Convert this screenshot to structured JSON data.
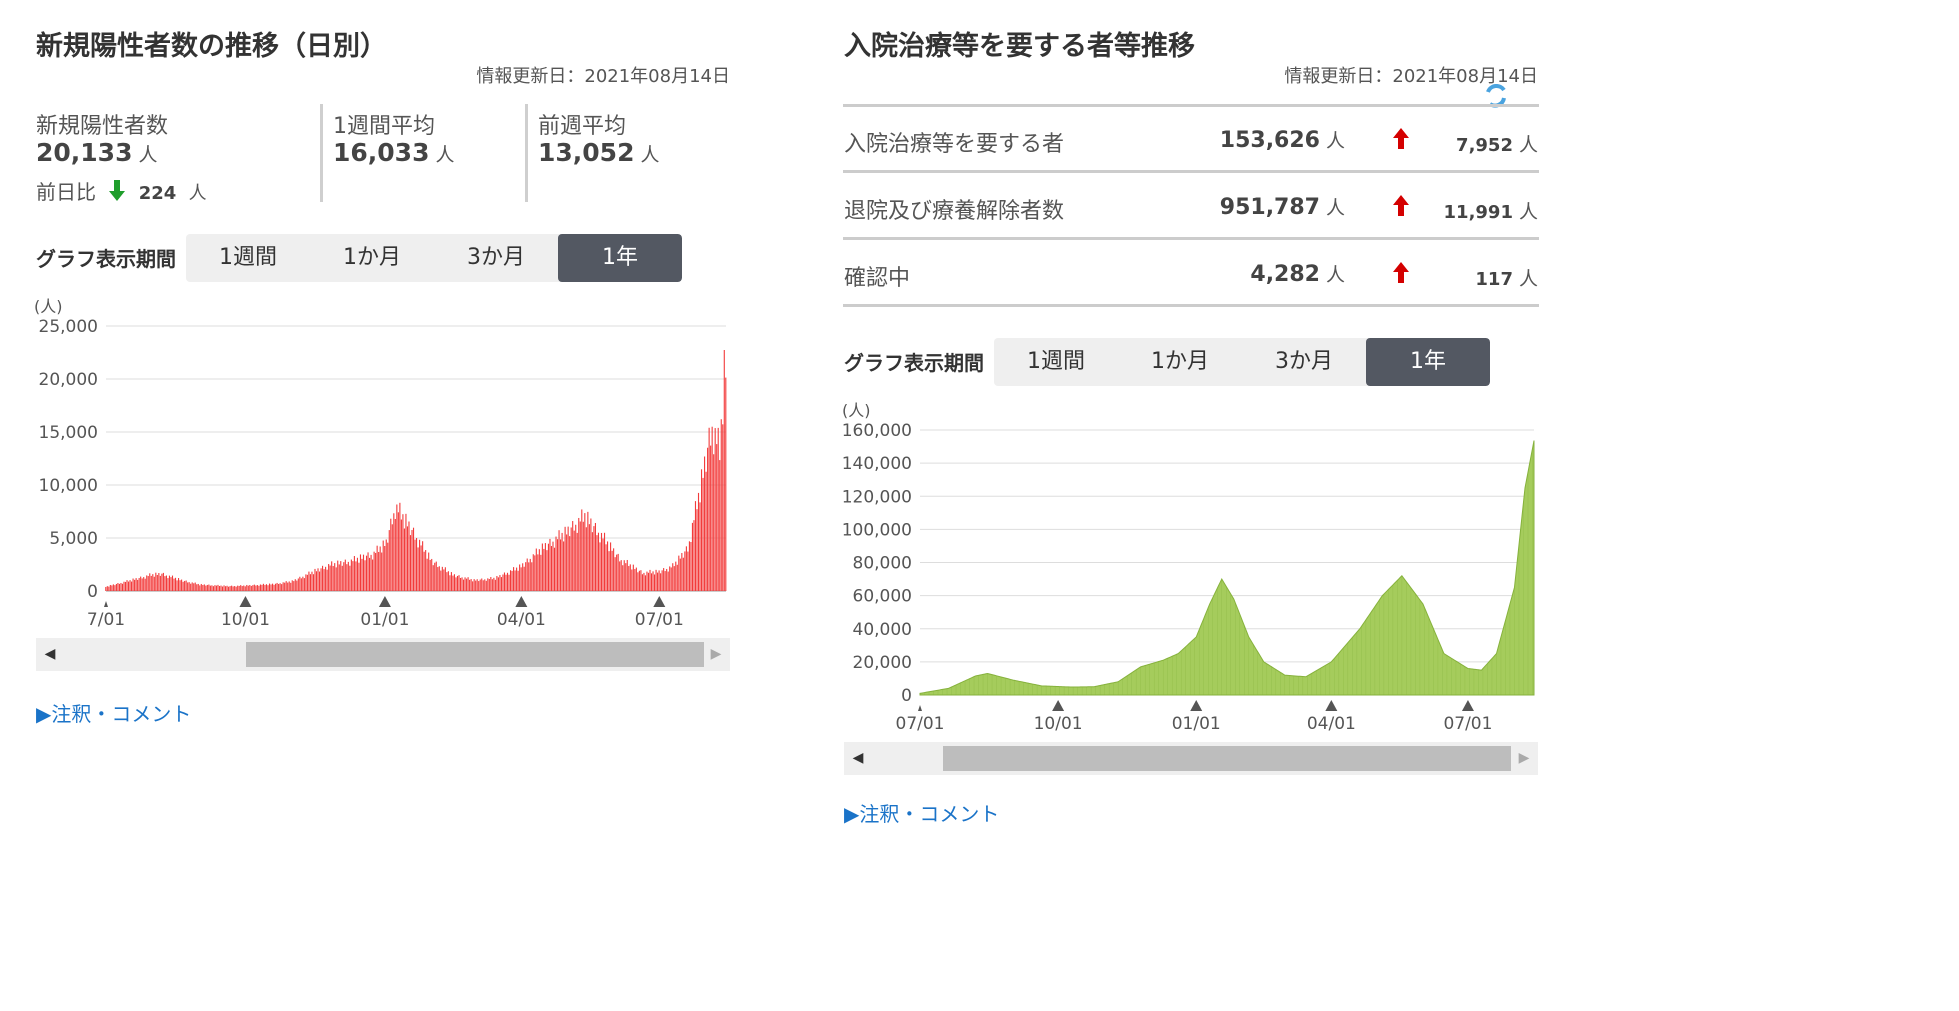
{
  "left": {
    "title": "新規陽性者数の推移（日別）",
    "updated": "情報更新日：2021年08月14日",
    "stats": {
      "new_cases_label": "新規陽性者数",
      "new_cases_value": "20,133",
      "unit": "人",
      "diff_label": "前日比",
      "diff_value": "224",
      "diff_direction": "down",
      "week_avg_label": "1週間平均",
      "week_avg_value": "16,033",
      "prev_week_avg_label": "前週平均",
      "prev_week_avg_value": "13,052"
    },
    "period": {
      "label": "グラフ表示期間",
      "options": [
        "1週間",
        "1か月",
        "3か月",
        "1年"
      ],
      "selected": "1年"
    },
    "note_link": "▶注釈・コメント"
  },
  "right": {
    "title": "入院治療等を要する者等推移",
    "updated": "情報更新日：2021年08月14日",
    "rows": [
      {
        "label": "入院治療等を要する者",
        "value": "153,626",
        "unit": "人",
        "direction": "up",
        "change": "7,952"
      },
      {
        "label": "退院及び療養解除者数",
        "value": "951,787",
        "unit": "人",
        "direction": "up",
        "change": "11,991"
      },
      {
        "label": "確認中",
        "value": "4,282",
        "unit": "人",
        "direction": "up",
        "change": "117"
      }
    ],
    "period": {
      "label": "グラフ表示期間",
      "options": [
        "1週間",
        "1か月",
        "3か月",
        "1年"
      ],
      "selected": "1年"
    },
    "note_link": "▶注釈・コメント"
  },
  "colors": {
    "red_bar": "#f23b3b",
    "green_area": "#a5cc5c",
    "green_line": "#86b23c",
    "down_arrow": "#1f9e2c",
    "up_arrow": "#d40000",
    "active_tab": "#535862"
  },
  "chart_data": [
    {
      "type": "bar",
      "ylabel": "(人)",
      "ylim": [
        0,
        25000
      ],
      "yticks": [
        "0",
        "5,000",
        "10,000",
        "15,000",
        "20,000",
        "25,000"
      ],
      "xticks": [
        "7/01",
        "10/01",
        "01/01",
        "04/01",
        "07/01"
      ],
      "grid": true,
      "x_range": [
        "2020-07-01",
        "2021-08-14"
      ],
      "points": [
        [
          "2020-07-01",
          400
        ],
        [
          "2020-07-15",
          900
        ],
        [
          "2020-07-31",
          1500
        ],
        [
          "2020-08-07",
          1600
        ],
        [
          "2020-08-20",
          1000
        ],
        [
          "2020-09-01",
          600
        ],
        [
          "2020-09-20",
          450
        ],
        [
          "2020-10-01",
          500
        ],
        [
          "2020-10-20",
          650
        ],
        [
          "2020-11-01",
          900
        ],
        [
          "2020-11-15",
          1800
        ],
        [
          "2020-11-25",
          2400
        ],
        [
          "2020-12-10",
          2800
        ],
        [
          "2020-12-25",
          3500
        ],
        [
          "2021-01-02",
          4500
        ],
        [
          "2021-01-08",
          7900
        ],
        [
          "2021-01-15",
          6500
        ],
        [
          "2021-01-22",
          5000
        ],
        [
          "2021-02-01",
          2800
        ],
        [
          "2021-02-15",
          1500
        ],
        [
          "2021-03-01",
          1000
        ],
        [
          "2021-03-15",
          1200
        ],
        [
          "2021-04-01",
          2300
        ],
        [
          "2021-04-15",
          4000
        ],
        [
          "2021-05-01",
          5500
        ],
        [
          "2021-05-13",
          7000
        ],
        [
          "2021-05-25",
          5000
        ],
        [
          "2021-06-05",
          3000
        ],
        [
          "2021-06-20",
          1700
        ],
        [
          "2021-07-01",
          1800
        ],
        [
          "2021-07-10",
          2300
        ],
        [
          "2021-07-20",
          4000
        ],
        [
          "2021-07-28",
          9500
        ],
        [
          "2021-08-05",
          15500
        ],
        [
          "2021-08-10",
          13000
        ],
        [
          "2021-08-13",
          20300
        ],
        [
          "2021-08-14",
          20133
        ]
      ]
    },
    {
      "type": "area",
      "ylabel": "(人)",
      "ylim": [
        0,
        160000
      ],
      "yticks": [
        "0",
        "20,000",
        "40,000",
        "60,000",
        "80,000",
        "100,000",
        "120,000",
        "140,000",
        "160,000"
      ],
      "xticks": [
        "07/01",
        "10/01",
        "01/01",
        "04/01",
        "07/01"
      ],
      "grid": true,
      "x_range": [
        "2020-07-01",
        "2021-08-14"
      ],
      "points": [
        [
          "2020-07-01",
          1000
        ],
        [
          "2020-07-20",
          4000
        ],
        [
          "2020-08-07",
          11500
        ],
        [
          "2020-08-15",
          13000
        ],
        [
          "2020-09-01",
          9000
        ],
        [
          "2020-09-20",
          5500
        ],
        [
          "2020-10-10",
          4800
        ],
        [
          "2020-10-25",
          5000
        ],
        [
          "2020-11-10",
          8000
        ],
        [
          "2020-11-25",
          17000
        ],
        [
          "2020-12-10",
          21000
        ],
        [
          "2020-12-20",
          25000
        ],
        [
          "2021-01-01",
          35000
        ],
        [
          "2021-01-10",
          55000
        ],
        [
          "2021-01-18",
          70000
        ],
        [
          "2021-01-26",
          58000
        ],
        [
          "2021-02-05",
          35000
        ],
        [
          "2021-02-15",
          20000
        ],
        [
          "2021-03-01",
          12000
        ],
        [
          "2021-03-15",
          11000
        ],
        [
          "2021-04-01",
          20000
        ],
        [
          "2021-04-20",
          40000
        ],
        [
          "2021-05-05",
          60000
        ],
        [
          "2021-05-18",
          72000
        ],
        [
          "2021-06-01",
          55000
        ],
        [
          "2021-06-15",
          25000
        ],
        [
          "2021-07-01",
          16000
        ],
        [
          "2021-07-10",
          15000
        ],
        [
          "2021-07-20",
          25000
        ],
        [
          "2021-08-01",
          65000
        ],
        [
          "2021-08-08",
          125000
        ],
        [
          "2021-08-14",
          153626
        ]
      ]
    }
  ]
}
